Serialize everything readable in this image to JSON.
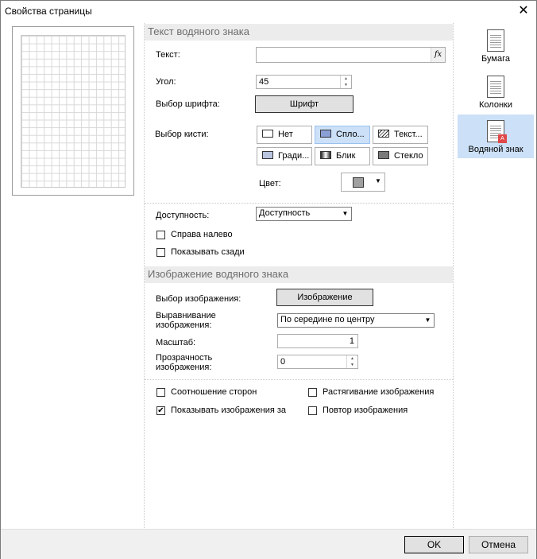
{
  "window": {
    "title": "Свойства страницы"
  },
  "sidebar": {
    "items": [
      {
        "label": "Бумага",
        "icon": "paper-icon"
      },
      {
        "label": "Колонки",
        "icon": "columns-icon"
      },
      {
        "label": "Водяной знак",
        "icon": "watermark-icon"
      }
    ]
  },
  "watermark_text": {
    "header": "Текст водяного знака",
    "text_label": "Текст:",
    "text_value": "",
    "fx_label": "fx",
    "angle_label": "Угол:",
    "angle_value": "45",
    "font_label": "Выбор шрифта:",
    "font_button": "Шрифт",
    "brush_label": "Выбор кисти:",
    "brushes": [
      "Нет",
      "Спло...",
      "Текст...",
      "Гради...",
      "Блик",
      "Стекло"
    ],
    "color_label": "Цвет:"
  },
  "availability": {
    "label": "Доступность:",
    "value": "Доступность",
    "right_to_left": "Справа налево",
    "show_behind": "Показывать сзади"
  },
  "watermark_image": {
    "header": "Изображение водяного знака",
    "image_select_label": "Выбор изображения:",
    "image_button": "Изображение",
    "align_label_1": "Выравнивание",
    "align_label_2": "изображения:",
    "align_value": "По середине по центру",
    "scale_label": "Масштаб:",
    "scale_value": "1",
    "transparency_label_1": "Прозрачность",
    "transparency_label_2": "изображения:",
    "transparency_value": "0"
  },
  "options": {
    "aspect_ratio": "Соотношение сторон",
    "stretch_image": "Растягивание изображения",
    "show_images_behind": "Показывать изображения за",
    "tile_image": "Повтор изображения"
  },
  "buttons": {
    "ok": "OK",
    "cancel": "Отмена"
  }
}
